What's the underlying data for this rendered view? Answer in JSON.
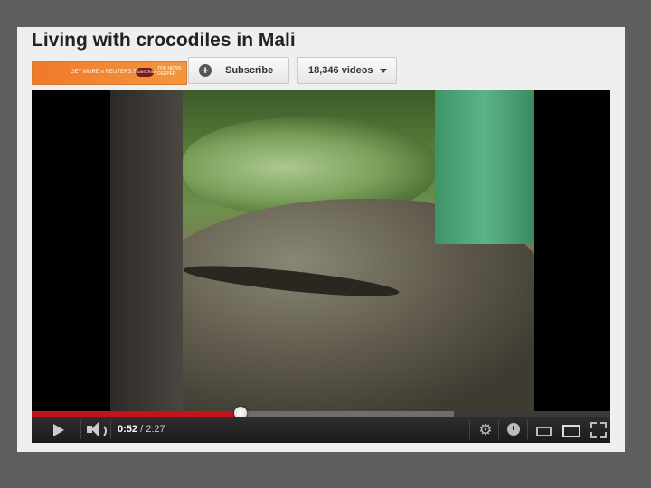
{
  "video": {
    "title": "Living with crocodiles in Mali",
    "time_current": "0:52",
    "time_separator": " / ",
    "time_total": "2:27",
    "progress_fraction": 0.361,
    "buffered_fraction": 0.73
  },
  "channel": {
    "banner_text": "GET MORE ≡ REUTERS.TV",
    "banner_subscribe": "SUBSCRIBE",
    "banner_tagline": "THE NEWS DEEPER"
  },
  "actions": {
    "subscribe_label": "Subscribe",
    "videos_label": "18,346 videos"
  },
  "icons": {
    "subscribe": "plus-icon",
    "dropdown": "chevron-down-icon",
    "play": "play-icon",
    "volume": "volume-icon",
    "settings": "gear-icon",
    "watch_later": "clock-icon",
    "small_player": "small-player-icon",
    "large_player": "large-player-icon",
    "fullscreen": "fullscreen-icon"
  },
  "colors": {
    "progress_played": "#c4141b",
    "banner": "#f0792a"
  }
}
